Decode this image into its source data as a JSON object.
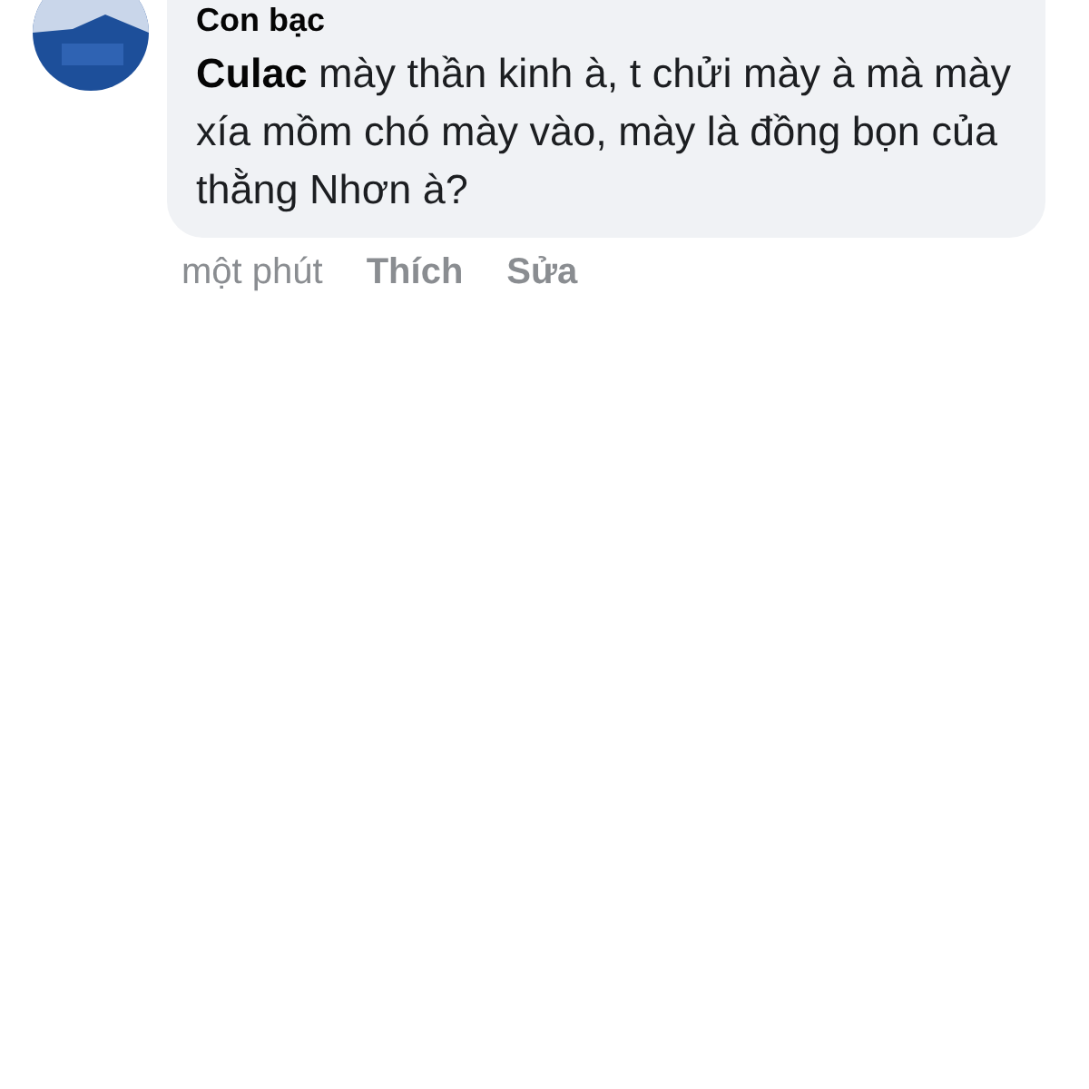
{
  "comment": {
    "author": "Con bạc",
    "text": "**Culac**  mày thần kinh à, t chửi mày à mà mày xía mồm chó mày vào, mày là đồng bọn của thằng Nhơn à?"
  },
  "actions": [
    {
      "kind": "time",
      "label": "một phút"
    },
    {
      "kind": "action",
      "label": "Thích"
    },
    {
      "kind": "action",
      "label": "Sửa"
    }
  ]
}
